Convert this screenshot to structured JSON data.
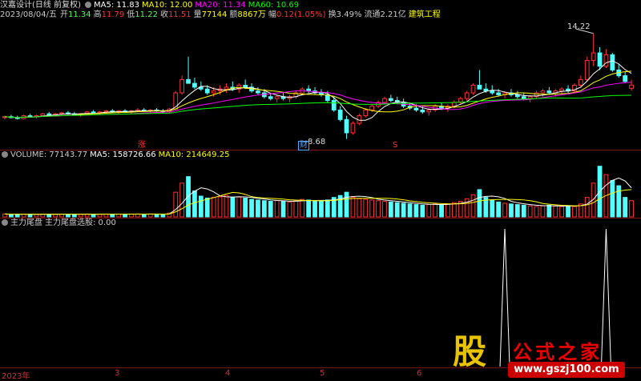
{
  "header": {
    "stock_name": "汉嘉设计(日线 前复权)",
    "ma5": "MA5: 11.83",
    "ma10": "MA10: 12.00",
    "ma20": "MA20: 11.34",
    "ma60": "MA60: 10.69"
  },
  "quote": {
    "date": "2023/08/04/五",
    "open_label": "开",
    "open": "11.34",
    "high_label": "高",
    "high": "11.79",
    "low_label": "低",
    "low": "11.22",
    "close_label": "收",
    "close": "11.51",
    "vol_label": "量",
    "vol": "77144",
    "amount_label": "额",
    "amount": "8867万",
    "change_label": "幅",
    "change": "0.12(1.05%)",
    "turnover": "换3.49%",
    "float": "流通2.21亿",
    "sector": "建筑工程"
  },
  "annotations": {
    "peak": "14.22",
    "low": "8.68",
    "marker_zhang": "涨",
    "marker_cai": "财",
    "marker_s": "S"
  },
  "volume_header": {
    "volume": "VOLUME: 77143.77",
    "ma5": "MA5: 158726.66",
    "ma10": "MA10: 214649.25"
  },
  "indicator_header": {
    "name": "主力尾盘",
    "sub": "主力尾盘选股: 0.00"
  },
  "time_axis": [
    "2023年",
    "3",
    "4",
    "5",
    "6"
  ],
  "colors": {
    "up": "#ff3232",
    "down": "#54ffff",
    "ma5": "#ffffff",
    "ma10": "#ffff00",
    "ma20": "#ff00ff",
    "ma60": "#00ff00",
    "frame": "#7a1010"
  },
  "watermark": {
    "logo": "股",
    "text": "公式之家",
    "url": "www.gszj100.com"
  },
  "chart_data": {
    "type": "candlestick",
    "y_range": [
      8.2,
      14.8
    ],
    "candles": [
      [
        9.8,
        9.9,
        9.7,
        9.85
      ],
      [
        9.85,
        9.95,
        9.75,
        9.8
      ],
      [
        9.8,
        9.9,
        9.7,
        9.75
      ],
      [
        9.75,
        9.95,
        9.7,
        9.9
      ],
      [
        9.9,
        10.0,
        9.8,
        9.85
      ],
      [
        9.85,
        9.95,
        9.75,
        9.9
      ],
      [
        9.9,
        10.05,
        9.85,
        10.0
      ],
      [
        10.0,
        10.1,
        9.9,
        9.95
      ],
      [
        9.95,
        10.05,
        9.85,
        10.0
      ],
      [
        10.0,
        10.1,
        9.9,
        10.05
      ],
      [
        10.05,
        10.15,
        9.95,
        10.0
      ],
      [
        10.0,
        10.1,
        9.9,
        9.95
      ],
      [
        9.95,
        10.05,
        9.85,
        10.0
      ],
      [
        10.0,
        10.15,
        9.95,
        10.1
      ],
      [
        10.1,
        10.2,
        10.0,
        10.05
      ],
      [
        10.05,
        10.15,
        9.95,
        10.1
      ],
      [
        10.1,
        10.2,
        10.0,
        10.15
      ],
      [
        10.15,
        10.25,
        10.05,
        10.1
      ],
      [
        10.1,
        10.2,
        10.0,
        10.15
      ],
      [
        10.15,
        10.25,
        10.05,
        10.1
      ],
      [
        10.1,
        10.2,
        10.0,
        10.15
      ],
      [
        10.15,
        10.3,
        10.1,
        10.2
      ],
      [
        10.2,
        10.3,
        10.1,
        10.15
      ],
      [
        10.15,
        10.25,
        10.05,
        10.2
      ],
      [
        10.2,
        10.3,
        10.1,
        10.15
      ],
      [
        10.15,
        10.25,
        10.05,
        10.1
      ],
      [
        10.1,
        10.3,
        10.05,
        10.25
      ],
      [
        10.25,
        11.2,
        10.2,
        11.1
      ],
      [
        11.1,
        12.0,
        11.0,
        11.8
      ],
      [
        11.8,
        13.0,
        11.7,
        11.6
      ],
      [
        11.6,
        11.9,
        11.3,
        11.4
      ],
      [
        11.4,
        11.7,
        11.2,
        11.3
      ],
      [
        11.3,
        11.5,
        11.0,
        11.1
      ],
      [
        11.1,
        11.4,
        10.9,
        11.2
      ],
      [
        11.2,
        11.5,
        11.0,
        11.3
      ],
      [
        11.3,
        11.6,
        11.1,
        11.4
      ],
      [
        11.4,
        11.7,
        11.2,
        11.3
      ],
      [
        11.3,
        11.6,
        11.1,
        11.5
      ],
      [
        11.5,
        11.8,
        11.3,
        11.4
      ],
      [
        11.4,
        11.6,
        11.1,
        11.2
      ],
      [
        11.2,
        11.4,
        11.0,
        11.1
      ],
      [
        11.1,
        11.3,
        10.8,
        10.9
      ],
      [
        10.9,
        11.1,
        10.7,
        10.8
      ],
      [
        10.8,
        11.0,
        10.6,
        10.9
      ],
      [
        10.9,
        11.1,
        10.7,
        10.8
      ],
      [
        10.8,
        11.0,
        10.6,
        10.9
      ],
      [
        10.9,
        11.2,
        10.8,
        11.1
      ],
      [
        11.1,
        11.4,
        11.0,
        11.3
      ],
      [
        11.3,
        11.5,
        11.1,
        11.2
      ],
      [
        11.2,
        11.4,
        11.0,
        11.1
      ],
      [
        11.1,
        11.3,
        10.9,
        11.0
      ],
      [
        11.0,
        11.2,
        10.6,
        10.7
      ],
      [
        10.7,
        10.9,
        10.1,
        10.2
      ],
      [
        10.2,
        10.4,
        9.6,
        9.7
      ],
      [
        9.7,
        9.9,
        8.68,
        9.0
      ],
      [
        9.0,
        9.6,
        8.9,
        9.5
      ],
      [
        9.5,
        10.0,
        9.4,
        9.9
      ],
      [
        9.9,
        10.3,
        9.8,
        10.2
      ],
      [
        10.2,
        10.5,
        10.1,
        10.4
      ],
      [
        10.4,
        10.7,
        10.3,
        10.6
      ],
      [
        10.6,
        10.9,
        10.5,
        10.8
      ],
      [
        10.8,
        11.0,
        10.6,
        10.7
      ],
      [
        10.7,
        10.9,
        10.5,
        10.6
      ],
      [
        10.6,
        10.8,
        10.3,
        10.4
      ],
      [
        10.4,
        10.6,
        10.2,
        10.3
      ],
      [
        10.3,
        10.5,
        10.1,
        10.2
      ],
      [
        10.2,
        10.4,
        10.0,
        10.1
      ],
      [
        10.1,
        10.3,
        9.9,
        10.2
      ],
      [
        10.2,
        10.5,
        10.1,
        10.4
      ],
      [
        10.4,
        10.6,
        10.2,
        10.3
      ],
      [
        10.3,
        10.5,
        10.1,
        10.4
      ],
      [
        10.4,
        10.7,
        10.3,
        10.6
      ],
      [
        10.6,
        10.9,
        10.5,
        10.8
      ],
      [
        10.8,
        11.2,
        10.7,
        11.1
      ],
      [
        11.1,
        11.6,
        11.0,
        11.5
      ],
      [
        11.5,
        12.3,
        11.4,
        11.3
      ],
      [
        11.3,
        11.6,
        11.1,
        11.2
      ],
      [
        11.2,
        11.5,
        11.0,
        11.1
      ],
      [
        11.1,
        11.3,
        10.9,
        11.0
      ],
      [
        11.0,
        11.2,
        10.8,
        11.1
      ],
      [
        11.1,
        11.3,
        10.9,
        11.0
      ],
      [
        11.0,
        11.2,
        10.8,
        10.9
      ],
      [
        10.9,
        11.1,
        10.7,
        10.8
      ],
      [
        10.8,
        11.0,
        10.6,
        10.9
      ],
      [
        10.9,
        11.2,
        10.8,
        11.1
      ],
      [
        11.1,
        11.3,
        10.9,
        11.2
      ],
      [
        11.2,
        11.4,
        11.0,
        11.1
      ],
      [
        11.1,
        11.3,
        10.9,
        11.2
      ],
      [
        11.2,
        11.4,
        11.0,
        11.3
      ],
      [
        11.3,
        11.5,
        11.1,
        11.2
      ],
      [
        11.2,
        11.6,
        11.1,
        11.5
      ],
      [
        11.5,
        12.0,
        11.4,
        11.8
      ],
      [
        11.8,
        13.0,
        11.7,
        12.8
      ],
      [
        12.8,
        14.22,
        12.5,
        13.2
      ],
      [
        13.2,
        13.5,
        12.3,
        12.5
      ],
      [
        12.5,
        13.4,
        12.4,
        13.1
      ],
      [
        13.1,
        13.2,
        12.2,
        12.3
      ],
      [
        12.3,
        12.6,
        11.9,
        12.0
      ],
      [
        12.0,
        12.2,
        11.6,
        11.7
      ],
      [
        11.34,
        11.79,
        11.22,
        11.51
      ]
    ],
    "volume_range": [
      0,
      850000
    ],
    "volumes": [
      45000,
      40000,
      38000,
      42000,
      40000,
      39000,
      44000,
      41000,
      40000,
      43000,
      42000,
      40000,
      41000,
      45000,
      43000,
      42000,
      44000,
      41000,
      43000,
      42000,
      44000,
      46000,
      43000,
      45000,
      42000,
      41000,
      60000,
      380000,
      520000,
      620000,
      400000,
      320000,
      290000,
      300000,
      310000,
      330000,
      300000,
      310000,
      290000,
      270000,
      260000,
      250000,
      240000,
      250000,
      240000,
      230000,
      250000,
      270000,
      260000,
      250000,
      240000,
      260000,
      300000,
      330000,
      380000,
      300000,
      280000,
      270000,
      260000,
      250000,
      240000,
      230000,
      220000,
      210000,
      200000,
      190000,
      180000,
      190000,
      200000,
      190000,
      200000,
      220000,
      240000,
      280000,
      340000,
      420000,
      300000,
      260000,
      230000,
      210000,
      200000,
      190000,
      180000,
      170000,
      160000,
      170000,
      180000,
      170000,
      160000,
      170000,
      160000,
      200000,
      300000,
      520000,
      780000,
      650000,
      560000,
      480000,
      300000,
      250000,
      77144
    ],
    "indicator_signals": [
      0,
      0,
      0,
      0,
      0,
      0,
      0,
      0,
      0,
      0,
      0,
      0,
      0,
      0,
      0,
      0,
      0,
      0,
      0,
      0,
      0,
      0,
      0,
      0,
      0,
      0,
      0,
      0,
      0,
      0,
      0,
      0,
      0,
      0,
      0,
      0,
      0,
      0,
      0,
      0,
      0,
      0,
      0,
      0,
      0,
      0,
      0,
      0,
      0,
      0,
      0,
      0,
      0,
      0,
      0,
      0,
      0,
      0,
      0,
      0,
      0,
      0,
      0,
      0,
      0,
      0,
      0,
      0,
      0,
      0,
      0,
      0,
      0,
      0,
      0,
      0,
      0,
      0,
      0,
      1,
      0,
      0,
      0,
      0,
      0,
      0,
      0,
      0,
      0,
      0,
      0,
      0,
      0,
      0,
      0,
      1,
      0,
      0,
      0,
      0,
      0,
      0,
      0,
      0
    ]
  }
}
